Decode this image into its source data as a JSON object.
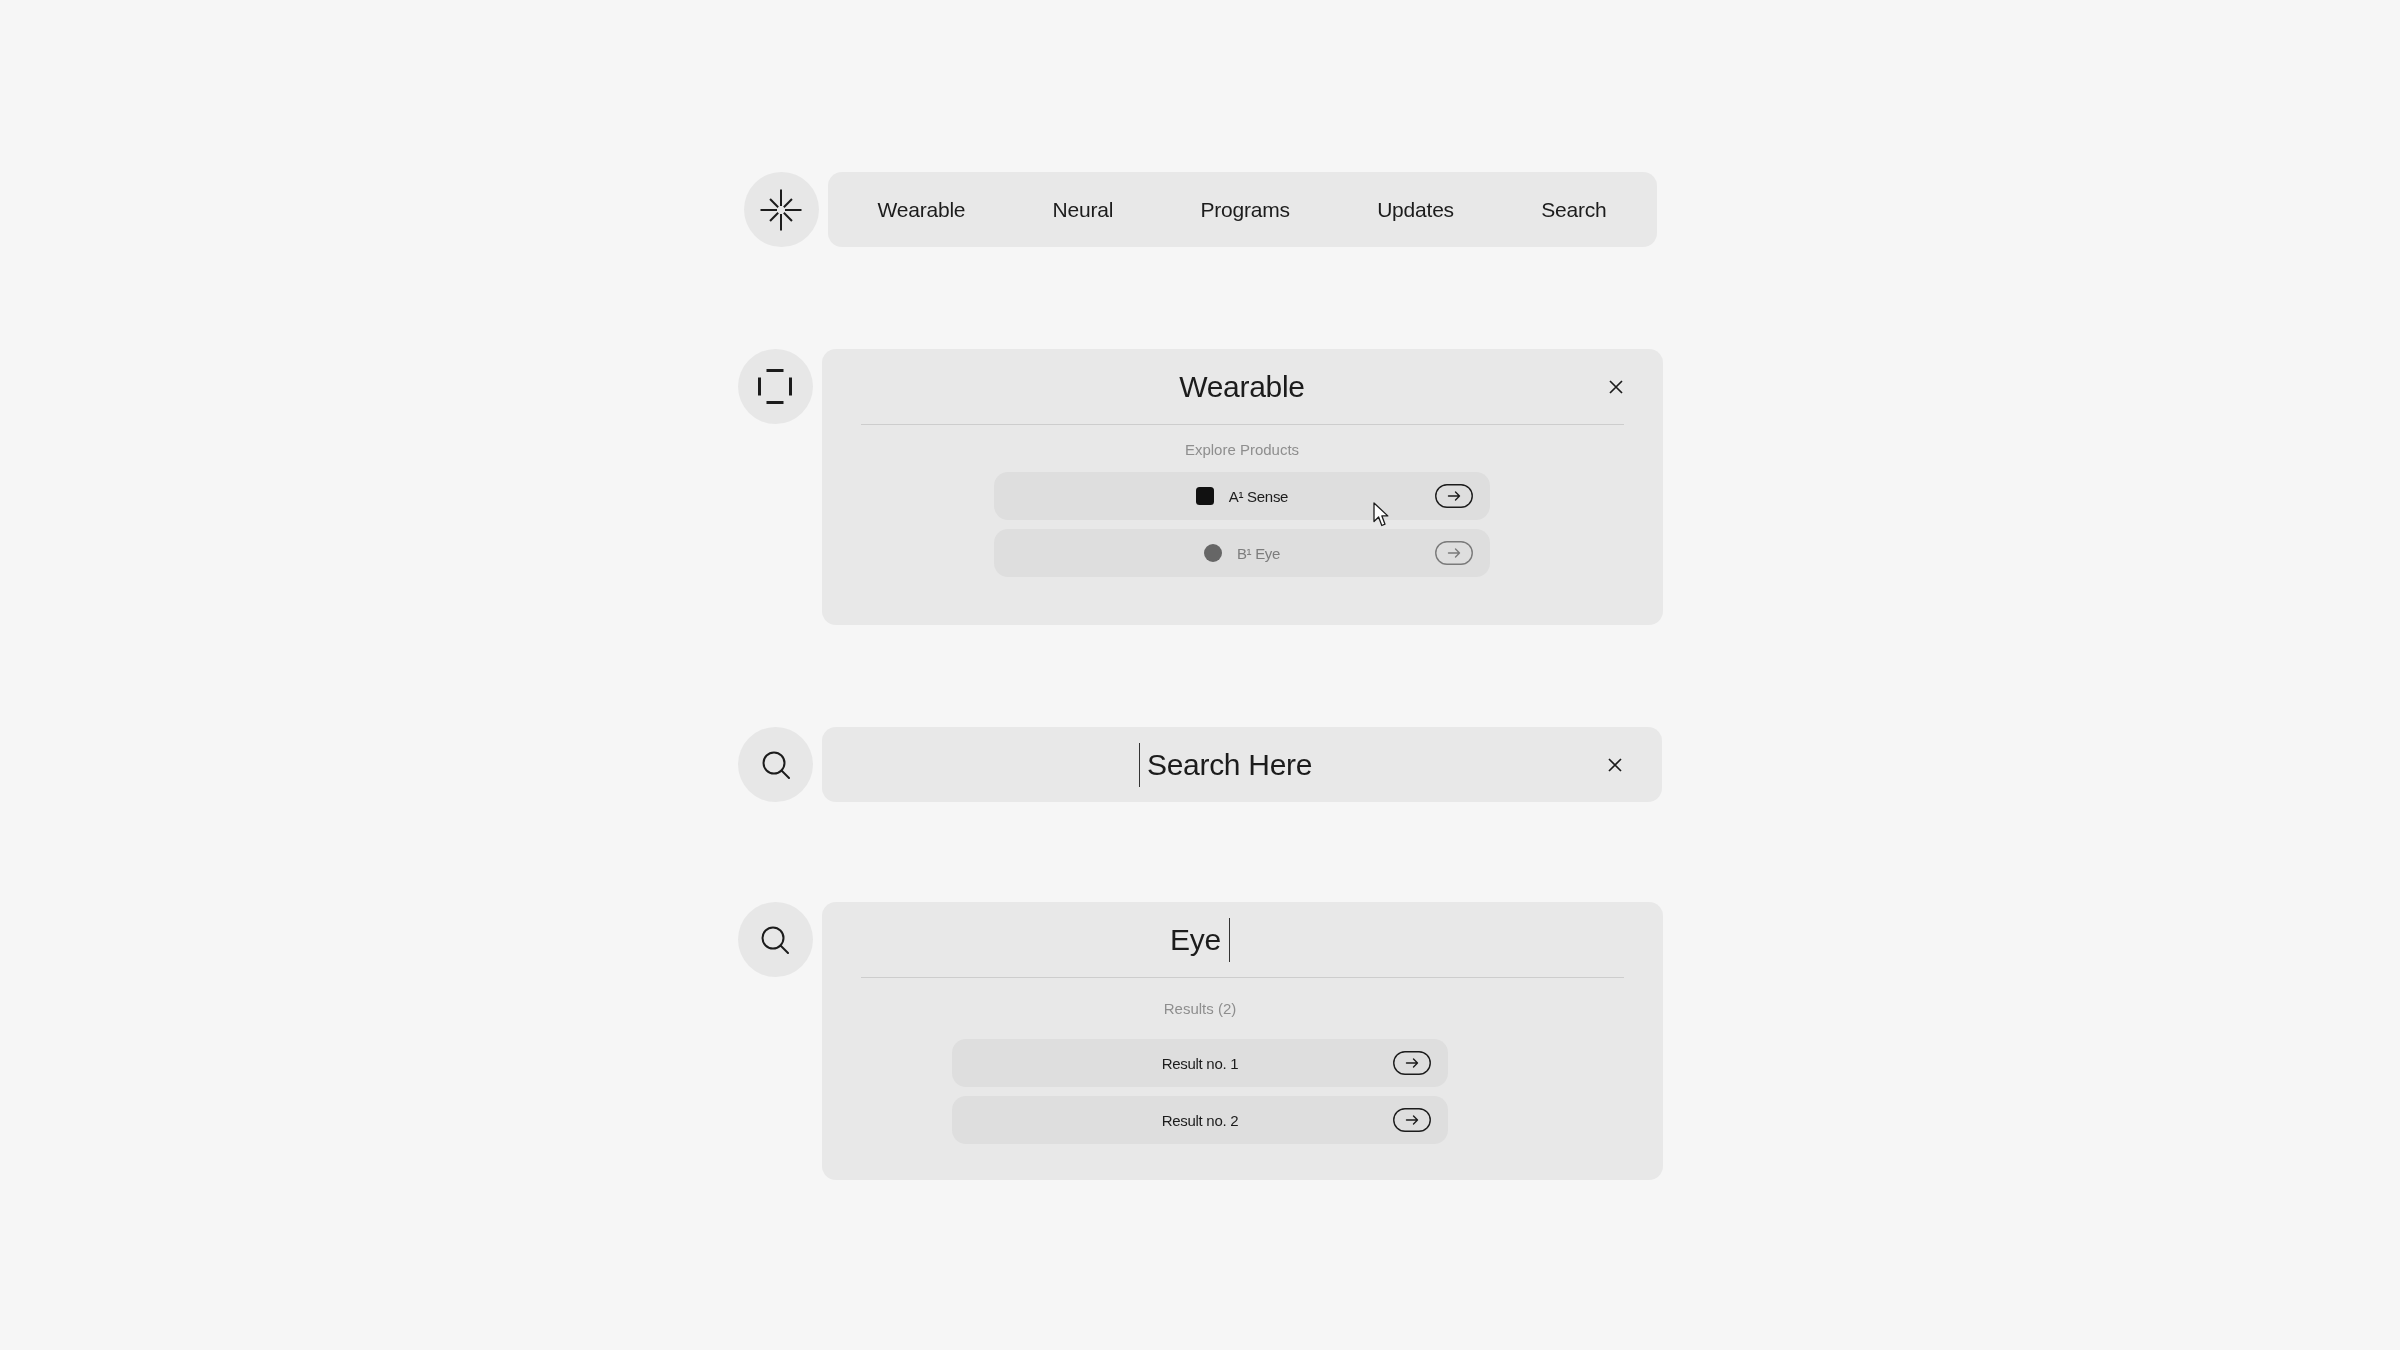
{
  "nav": {
    "items": [
      "Wearable",
      "Neural",
      "Programs",
      "Updates",
      "Search"
    ]
  },
  "dropdown": {
    "title": "Wearable",
    "section_label": "Explore Products",
    "products": [
      {
        "name": "A¹ Sense",
        "kind": "square",
        "disabled": false,
        "hovered": true
      },
      {
        "name": "B¹ Eye",
        "kind": "circle",
        "disabled": true,
        "hovered": false
      }
    ]
  },
  "search_bar": {
    "placeholder": "Search Here",
    "focused": true
  },
  "search_results": {
    "query": "Eye",
    "focused": true,
    "results_label": "Results (2)",
    "results": [
      "Result no. 1",
      "Result no. 2"
    ]
  }
}
